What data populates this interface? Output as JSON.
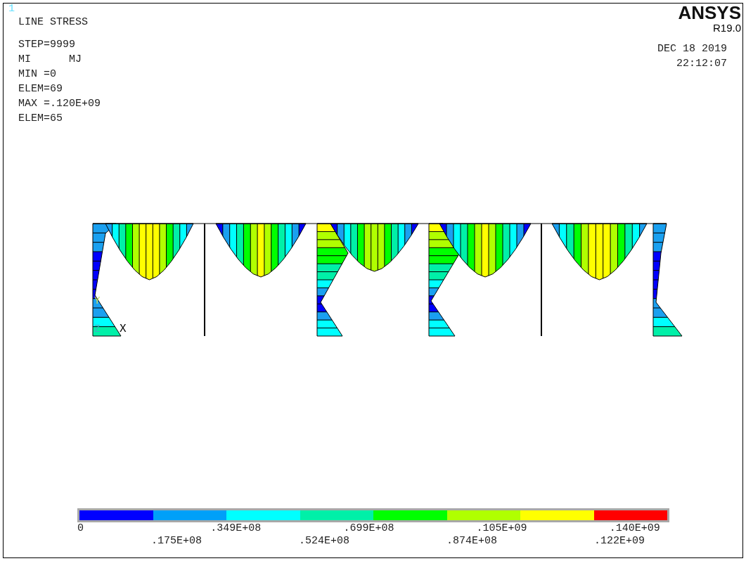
{
  "window": {
    "number": "1"
  },
  "header": {
    "title": "LINE STRESS",
    "info_lines": [
      "STEP=9999",
      "MI      MJ",
      "MIN =0",
      "ELEM=69",
      "MAX =.120E+09",
      "ELEM=65"
    ],
    "logo": "ANSYS",
    "version": "R19.0",
    "date": "DEC 18 2019",
    "time": "22:12:07"
  },
  "triad": {
    "y_label": "Y",
    "z_label": "Z",
    "x_label": "X"
  },
  "legend": {
    "levels": [
      {
        "color": "#0000ff"
      },
      {
        "color": "#00a0f8"
      },
      {
        "color": "#00ffff"
      },
      {
        "color": "#00f0a8"
      },
      {
        "color": "#00ff00"
      },
      {
        "color": "#b0ff00"
      },
      {
        "color": "#ffff00"
      },
      {
        "color": "#ff0000"
      }
    ],
    "labels": [
      "0",
      ".175E+08",
      ".349E+08",
      ".524E+08",
      ".699E+08",
      ".874E+08",
      ".105E+09",
      ".122E+09",
      ".140E+09"
    ]
  }
}
